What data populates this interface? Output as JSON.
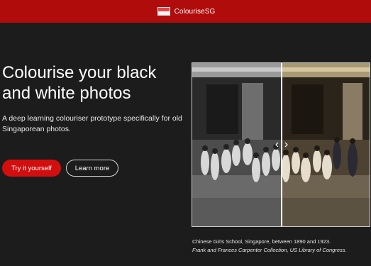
{
  "header": {
    "brand_name": "ColouriseSG",
    "flag_colors": {
      "top": "#e04848",
      "bottom": "#f4f4f4"
    },
    "background_color": "#b00c0c"
  },
  "hero": {
    "title": "Colourise your black and white photos",
    "subtitle": "A deep learning colouriser prototype specifically for old Singaporean photos.",
    "primary_button": "Try it yourself",
    "secondary_button": "Learn more"
  },
  "image": {
    "description_alt": "Before and after comparison photo",
    "slider_icon": "split-slider-icon",
    "caption": "Chinese Girls School, Singapore, between 1890 and 1923.",
    "credit": "Frank and Frances Carpenter Collection, US Library of Congress."
  },
  "colors": {
    "accent_red": "#d30e0e",
    "page_background": "#1d1c1d"
  }
}
